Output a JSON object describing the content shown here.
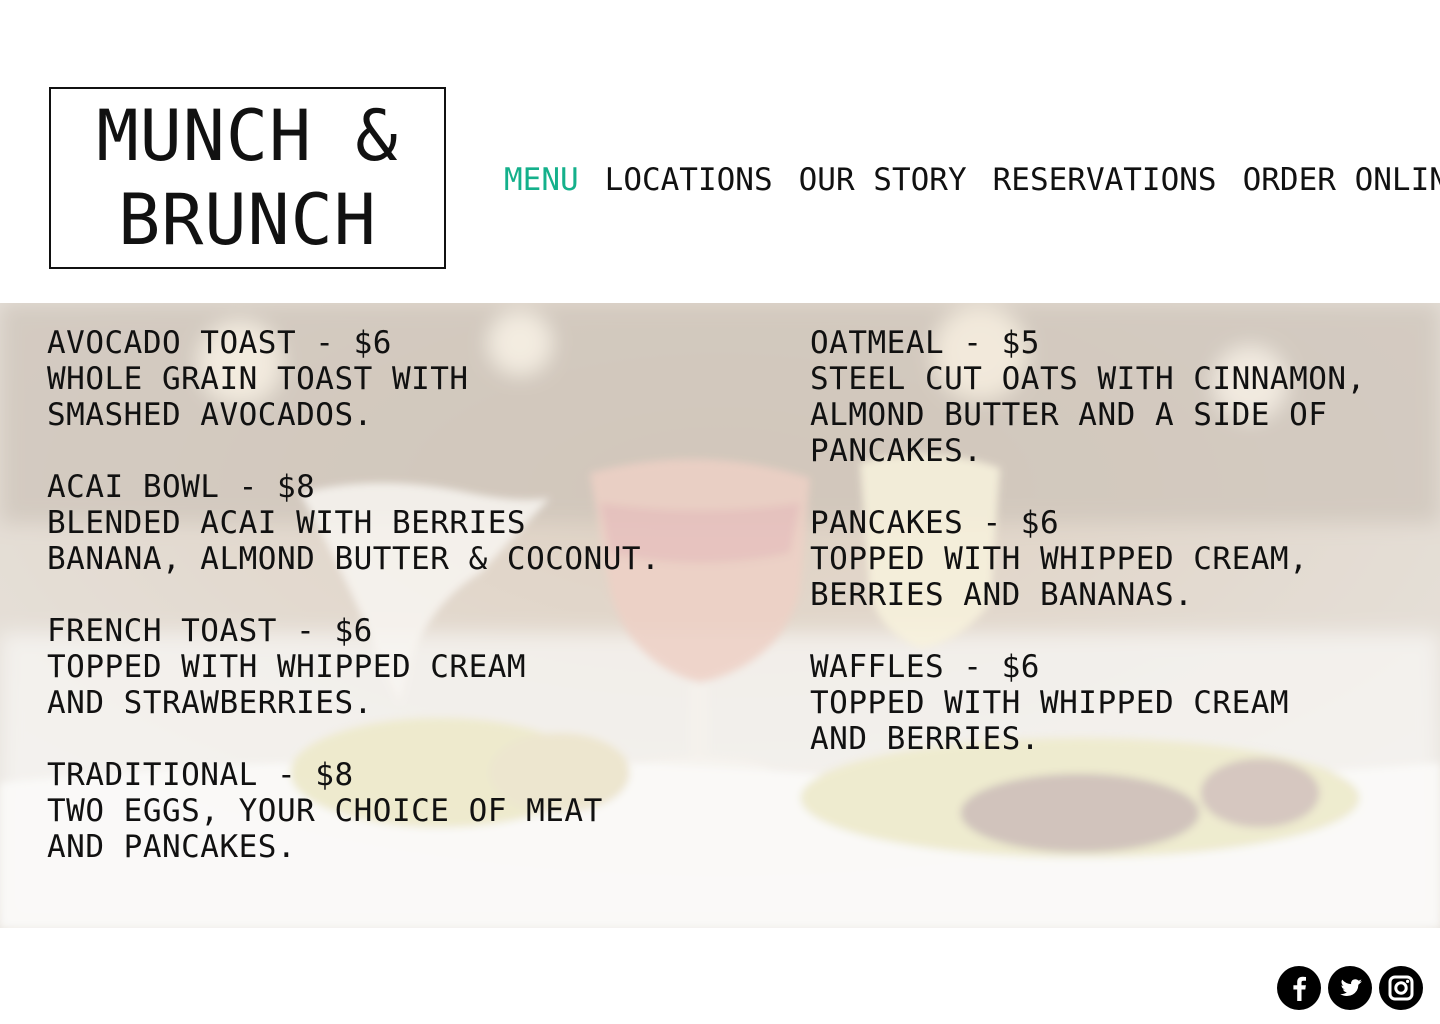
{
  "brand": {
    "line1": "MUNCH &",
    "line2": "BRUNCH"
  },
  "nav": {
    "items": [
      {
        "label": "MENU",
        "active": true
      },
      {
        "label": "LOCATIONS",
        "active": false
      },
      {
        "label": "OUR STORY",
        "active": false
      },
      {
        "label": "RESERVATIONS",
        "active": false
      },
      {
        "label": "ORDER ONLINE",
        "active": false
      }
    ],
    "active_color": "#14b08b"
  },
  "menu": {
    "left": [
      {
        "title": "AVOCADO TOAST - $6",
        "desc": "WHOLE GRAIN TOAST WITH\nSMASHED AVOCADOS."
      },
      {
        "title": "ACAI BOWL - $8",
        "desc": "BLENDED ACAI WITH BERRIES\nBANANA, ALMOND BUTTER & COCONUT."
      },
      {
        "title": "FRENCH TOAST - $6",
        "desc": "TOPPED WITH WHIPPED CREAM\nAND STRAWBERRIES."
      },
      {
        "title": "TRADITIONAL - $8",
        "desc": "TWO EGGS, YOUR CHOICE OF MEAT\nAND PANCAKES."
      }
    ],
    "right": [
      {
        "title": "OATMEAL - $5",
        "desc": "STEEL CUT OATS WITH CINNAMON,\nALMOND BUTTER AND A SIDE OF\nPANCAKES."
      },
      {
        "title": "PANCAKES - $6",
        "desc": "TOPPED WITH WHIPPED CREAM,\nBERRIES AND BANANAS."
      },
      {
        "title": "WAFFLES - $6",
        "desc": "TOPPED WITH WHIPPED CREAM\nAND BERRIES."
      }
    ]
  },
  "social": {
    "icons": [
      "facebook-icon",
      "twitter-icon",
      "instagram-icon"
    ]
  }
}
